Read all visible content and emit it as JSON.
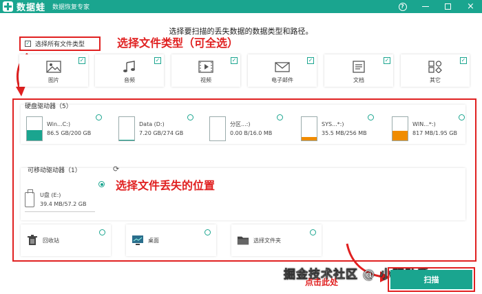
{
  "titlebar": {
    "brand": "数据蛙",
    "subtitle": "数据恢复专家",
    "help": "?",
    "close": "×"
  },
  "instruction": "选择要扫描的丢失数据的数据类型和路径。",
  "select_all": {
    "label": "选择所有文件类型",
    "checked": true
  },
  "annotations": {
    "select_types": "选择文件类型（可全选）",
    "select_location": "选择文件丢失的位置",
    "click_here": "点击此处"
  },
  "file_types": [
    {
      "label": "图片",
      "icon": "image-icon",
      "checked": true
    },
    {
      "label": "音频",
      "icon": "music-icon",
      "checked": true
    },
    {
      "label": "视频",
      "icon": "video-icon",
      "checked": true
    },
    {
      "label": "电子邮件",
      "icon": "email-icon",
      "checked": true
    },
    {
      "label": "文档",
      "icon": "document-icon",
      "checked": true
    },
    {
      "label": "其它",
      "icon": "other-icon",
      "checked": true
    }
  ],
  "hard_drives": {
    "title": "硬盘驱动器（5）",
    "items": [
      {
        "name": "Win...C:)",
        "size": "86.5 GB/200 GB",
        "used_fraction": 0.43,
        "color": "#1aa58f"
      },
      {
        "name": "Data (D:)",
        "size": "7.20 GB/274 GB",
        "used_fraction": 0.03,
        "color": "#1aa58f"
      },
      {
        "name": "分区...:)",
        "size": "0.00  B/16.0 MB",
        "used_fraction": 0.0,
        "color": "#f0a030"
      },
      {
        "name": "SYS...*:)",
        "size": "35.5 MB/256 MB",
        "used_fraction": 0.14,
        "color": "#f08c00"
      },
      {
        "name": "WIN...*:)",
        "size": "817 MB/1.95 GB",
        "used_fraction": 0.42,
        "color": "#f08c00"
      }
    ]
  },
  "removable": {
    "title": "可移动驱动器（1）",
    "refresh_icon": "refresh-icon",
    "items": [
      {
        "name": "U盘 (E:)",
        "size": "39.4 MB/57.2 GB",
        "selected": true
      }
    ]
  },
  "locations": [
    {
      "label": "回收站",
      "icon": "recycle-bin-icon"
    },
    {
      "label": "桌面",
      "icon": "desktop-icon"
    },
    {
      "label": "选择文件夹",
      "icon": "folder-icon"
    }
  ],
  "watermark": "掘金技术社区 @ 小明助手",
  "scan_button": "扫描"
}
